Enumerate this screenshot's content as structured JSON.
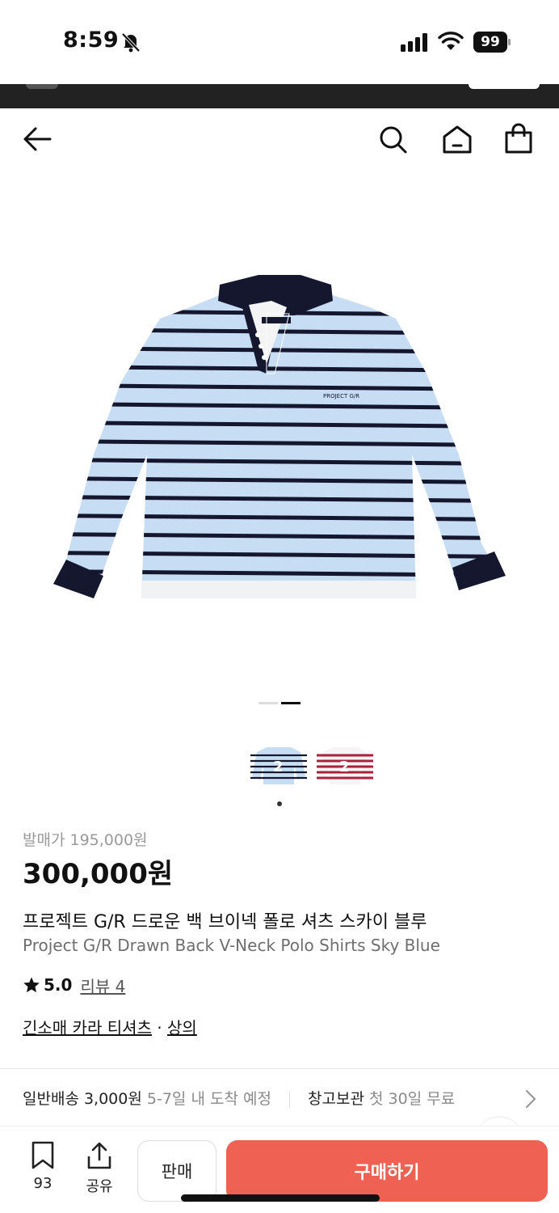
{
  "status_bar": {
    "time": "8:59",
    "battery": "99"
  },
  "nav": {
    "icons": [
      "back-arrow-icon",
      "search-icon",
      "home-icon",
      "shopping-bag-icon"
    ]
  },
  "product": {
    "original_price": "발매가 195,000원",
    "price": "300,000원",
    "title_ko": "프로젝트 G/R 드로운 백 브이넥 폴로 셔츠 스카이 블루",
    "title_en": "Project G/R Drawn Back V-Neck Polo Shirts Sky Blue",
    "rating": "5.0",
    "reviews_label": "리뷰 4",
    "category_main": "긴소매 카라 티셔츠",
    "category_separator": "·",
    "category_sub": "상의"
  },
  "shipping": {
    "label": "일반배송 3,000원",
    "eta": "5-7일 내 도착 예정",
    "storage_label": "창고보관",
    "storage_desc": "첫 30일 무료"
  },
  "bottom_bar": {
    "bookmark_count": "93",
    "share_label": "공유",
    "sell_label": "판매",
    "buy_label": "구매하기"
  },
  "colors": {
    "accent": "#ef6253",
    "shirt": "#c7ddf3",
    "stripe": "#15172e",
    "thumb2": "#a8223a"
  }
}
